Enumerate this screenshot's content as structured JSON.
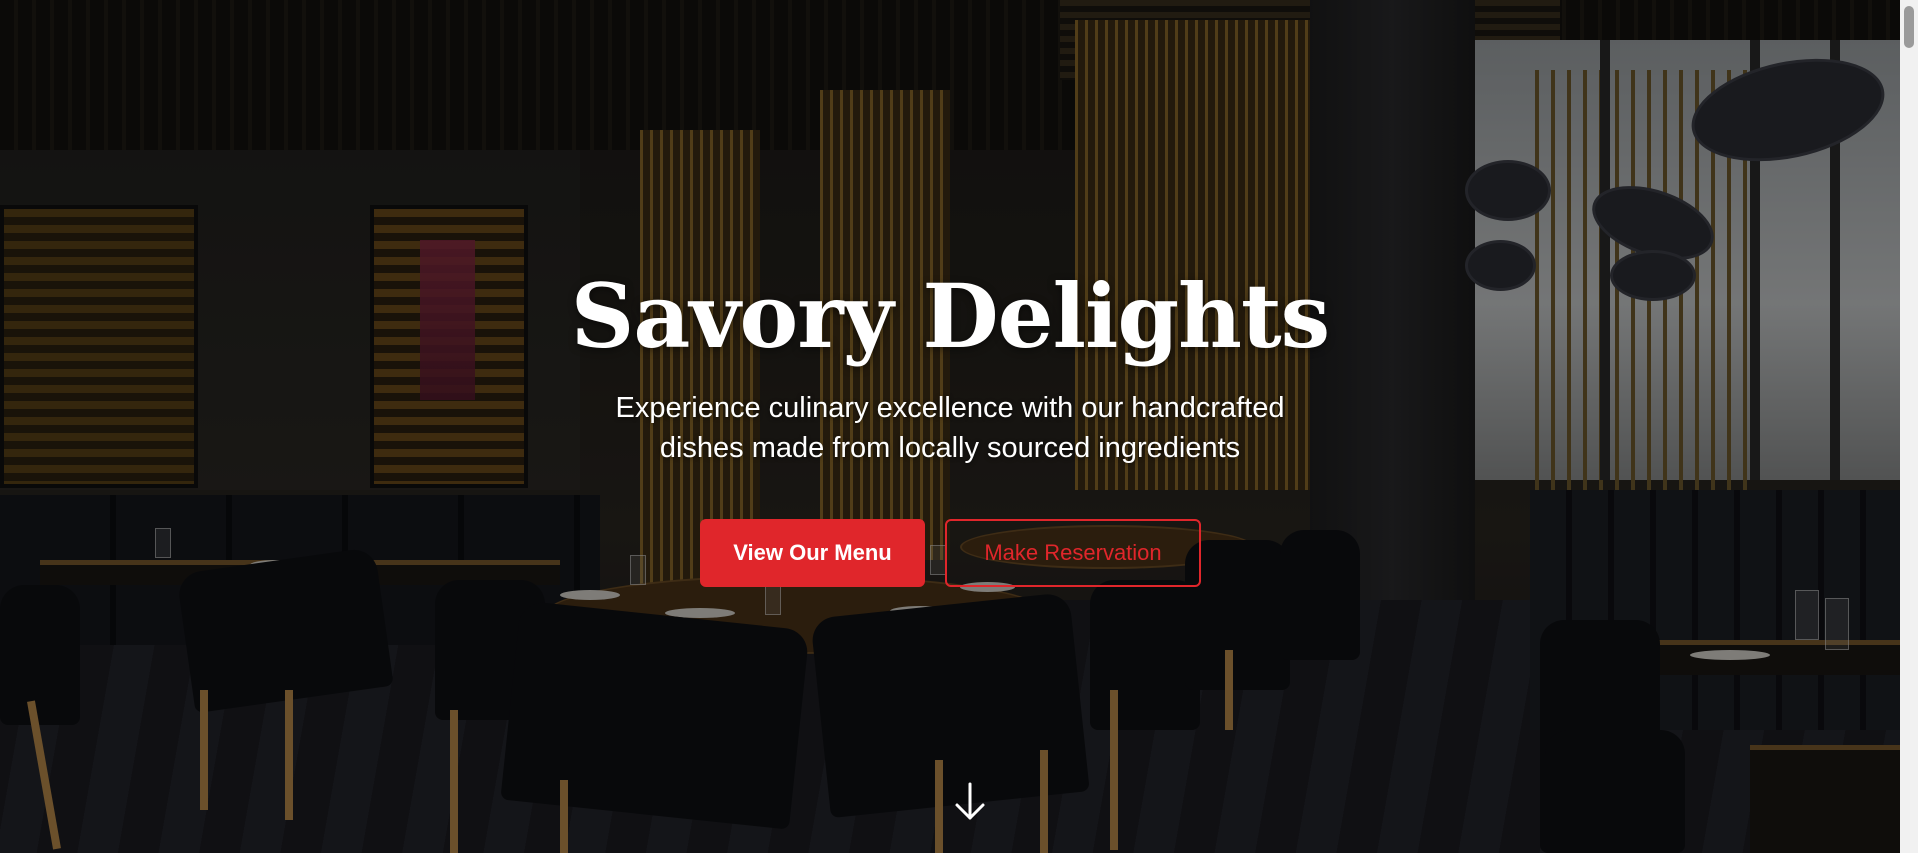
{
  "hero": {
    "title": "Savory Delights",
    "subtitle_line1": "Experience culinary excellence with our handcrafted",
    "subtitle_line2": "dishes made from locally sourced ingredients",
    "primary_button": "View Our Menu",
    "secondary_button": "Make Reservation",
    "scroll_icon": "arrow-down-icon",
    "background_image": "restaurant-interior-photo"
  },
  "colors": {
    "accent": "#e0262b",
    "text": "#ffffff",
    "overlay": "rgba(0,0,0,0.42)"
  }
}
